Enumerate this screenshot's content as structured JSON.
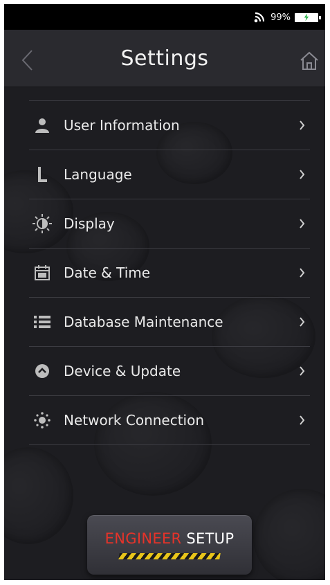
{
  "status_bar": {
    "battery_percent": "99%",
    "battery_level": 0.99,
    "icons": [
      "signal-icon",
      "battery-charging-icon"
    ]
  },
  "header": {
    "title": "Settings",
    "back_icon": "back-chevron-icon",
    "home_icon": "home-icon"
  },
  "menu": {
    "items": [
      {
        "label": "User Information",
        "icon": "user-icon"
      },
      {
        "label": "Language",
        "icon": "language-icon"
      },
      {
        "label": "Display",
        "icon": "display-brightness-icon"
      },
      {
        "label": "Date & Time",
        "icon": "calendar-icon"
      },
      {
        "label": "Database Maintenance",
        "icon": "list-icon"
      },
      {
        "label": "Device & Update",
        "icon": "update-icon"
      },
      {
        "label": "Network Connection",
        "icon": "network-icon"
      }
    ],
    "chevron_icon": "chevron-right-icon"
  },
  "engineer_setup": {
    "label_part1": "ENGINEER",
    "label_part2": "SETUP",
    "accent_color": "#e5332a",
    "stripe_color": "#e8c51a"
  },
  "colors": {
    "background": "#1d1d21",
    "header": "#2a2a2f",
    "status_bar": "#000000",
    "text": "#eaeaea"
  }
}
